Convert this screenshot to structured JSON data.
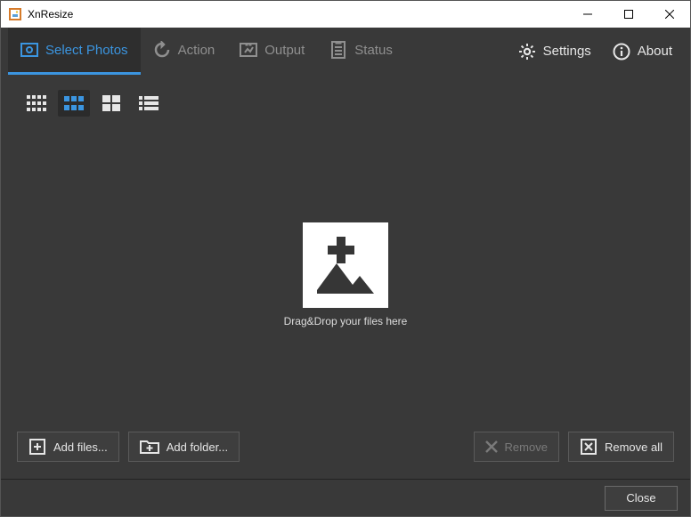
{
  "window": {
    "title": "XnResize"
  },
  "tabs": {
    "select_photos": "Select Photos",
    "action": "Action",
    "output": "Output",
    "status": "Status"
  },
  "top_right": {
    "settings": "Settings",
    "about": "About"
  },
  "dropzone": {
    "hint": "Drag&Drop your files here"
  },
  "actions": {
    "add_files": "Add files...",
    "add_folder": "Add folder...",
    "remove": "Remove",
    "remove_all": "Remove all"
  },
  "footer": {
    "close": "Close"
  }
}
